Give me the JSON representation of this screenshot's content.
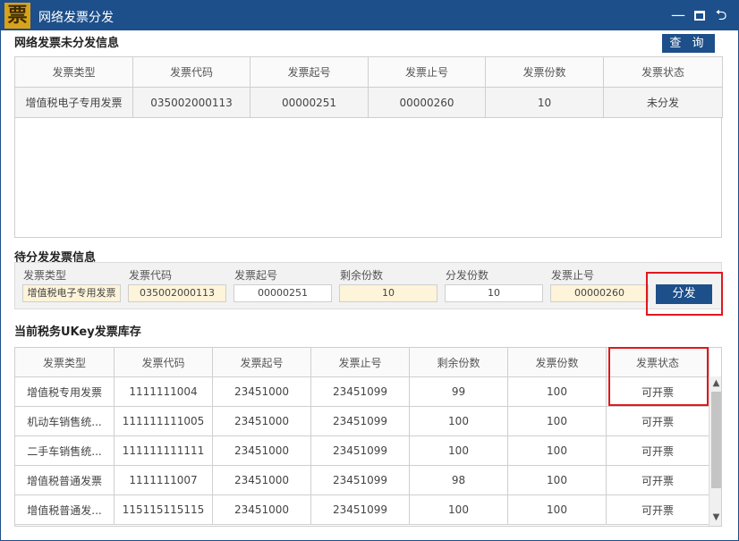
{
  "window": {
    "logo": "票",
    "title": "网络发票分发",
    "minimize": "—",
    "back": "⮌"
  },
  "undistributed": {
    "title": "网络发票未分发信息",
    "query_button": "查 询",
    "columns": [
      "发票类型",
      "发票代码",
      "发票起号",
      "发票止号",
      "发票份数",
      "发票状态"
    ],
    "rows": [
      [
        "增值税电子专用发票",
        "035002000113",
        "00000251",
        "00000260",
        "10",
        "未分发"
      ]
    ]
  },
  "pending": {
    "title": "待分发发票信息",
    "fields": [
      {
        "label": "发票类型",
        "value": "增值税电子专用发票"
      },
      {
        "label": "发票代码",
        "value": "035002000113"
      },
      {
        "label": "发票起号",
        "value": "00000251"
      },
      {
        "label": "剩余份数",
        "value": "10"
      },
      {
        "label": "分发份数",
        "value": "10"
      },
      {
        "label": "发票止号",
        "value": "00000260"
      }
    ],
    "distribute_button": "分发"
  },
  "inventory": {
    "title": "当前税务UKey发票库存",
    "columns": [
      "发票类型",
      "发票代码",
      "发票起号",
      "发票止号",
      "剩余份数",
      "发票份数",
      "发票状态"
    ],
    "rows": [
      [
        "增值税专用发票",
        "1111111004",
        "23451000",
        "23451099",
        "99",
        "100",
        "可开票"
      ],
      [
        "机动车销售统...",
        "111111111005",
        "23451000",
        "23451099",
        "100",
        "100",
        "可开票"
      ],
      [
        "二手车销售统...",
        "111111111111",
        "23451000",
        "23451099",
        "100",
        "100",
        "可开票"
      ],
      [
        "增值税普通发票",
        "1111111007",
        "23451000",
        "23451099",
        "98",
        "100",
        "可开票"
      ],
      [
        "增值税普通发...",
        "115115115115",
        "23451000",
        "23451099",
        "100",
        "100",
        "可开票"
      ]
    ]
  },
  "colors": {
    "titlebar": "#1d4f8a",
    "button": "#1d4f8a",
    "highlight": "#e0181e",
    "field_yellow": "#fdf4d9"
  }
}
